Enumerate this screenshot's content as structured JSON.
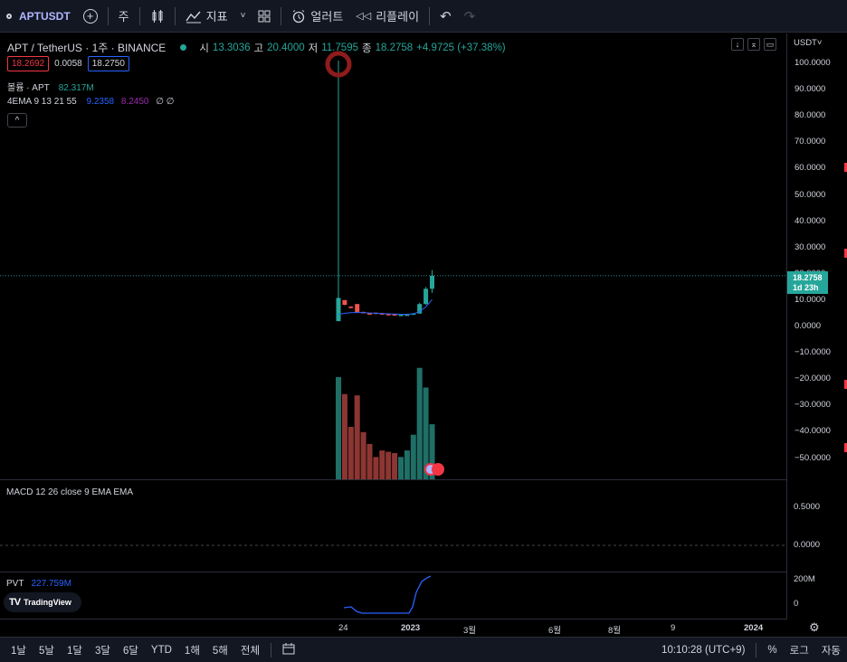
{
  "toolbar": {
    "symbol": "APTUSDT",
    "interval": "주",
    "indicators_label": "지표",
    "alert_label": "얼러트",
    "replay_label": "리플레이"
  },
  "legend": {
    "title": "APT / TetherUS · 1주 · BINANCE",
    "open_label": "시",
    "open": "13.3036",
    "high_label": "고",
    "high": "20.4000",
    "low_label": "저",
    "low": "11.7595",
    "close_label": "종",
    "close": "18.2758",
    "change": "+4.9725 (+37.38%)",
    "bid": "18.2692",
    "spread": "0.0058",
    "ask": "18.2750",
    "volume_label": "볼륨 · APT",
    "volume_value": "82.317M",
    "ema_label": "4EMA 9 13 21 55",
    "ema_v1": "9.2358",
    "ema_v2": "8.2450",
    "ema_rest": "∅ ∅"
  },
  "price_axis": {
    "currency": "USDT˅",
    "ticks": [
      "100.0000",
      "90.0000",
      "80.0000",
      "70.0000",
      "60.0000",
      "50.0000",
      "40.0000",
      "30.0000",
      "20.0000",
      "10.0000",
      "0.0000",
      "−10.0000",
      "−20.0000",
      "−30.0000",
      "−40.0000",
      "−50.0000"
    ],
    "last_price": "18.2758",
    "countdown": "1d 23h"
  },
  "macd": {
    "label": "MACD 12 26 close 9 EMA EMA",
    "ticks": [
      "0.5000",
      "0.0000"
    ]
  },
  "pvt": {
    "label": "PVT",
    "value": "227.759M",
    "ticks": [
      "200M",
      "0"
    ]
  },
  "branding": "TradingView",
  "time_axis": [
    "24",
    "2023",
    "3월",
    "6월",
    "8월",
    "9",
    "2024"
  ],
  "bottombar": {
    "ranges": [
      "1날",
      "5날",
      "1달",
      "3달",
      "6달",
      "YTD",
      "1해",
      "5해",
      "전체"
    ],
    "clock": "10:10:28 (UTC+9)",
    "percent": "%",
    "log": "로그",
    "auto": "자동"
  },
  "colors": {
    "up": "#26a69a",
    "down": "#ef5350",
    "ema_fast": "#2962ff",
    "ema_slow": "#9c27b0",
    "background": "#000000"
  },
  "chart_data": {
    "type": "candlestick",
    "y_range": [
      -55,
      105
    ],
    "candles": [
      {
        "o": 1.0,
        "h": 100.0,
        "l": 1.0,
        "c": 9.8,
        "vol": 78
      },
      {
        "o": 9.0,
        "h": 9.0,
        "l": 7.0,
        "c": 7.2,
        "vol": 65
      },
      {
        "o": 6.5,
        "h": 6.7,
        "l": 5.8,
        "c": 6.0,
        "vol": 40
      },
      {
        "o": 7.5,
        "h": 7.5,
        "l": 4.2,
        "c": 4.5,
        "vol": 64
      },
      {
        "o": 4.5,
        "h": 4.6,
        "l": 4.0,
        "c": 4.1,
        "vol": 36
      },
      {
        "o": 4.0,
        "h": 4.2,
        "l": 3.7,
        "c": 3.9,
        "vol": 27
      },
      {
        "o": 4.2,
        "h": 4.3,
        "l": 4.0,
        "c": 4.0,
        "vol": 17
      },
      {
        "o": 4.0,
        "h": 4.2,
        "l": 3.6,
        "c": 3.8,
        "vol": 22
      },
      {
        "o": 3.7,
        "h": 3.8,
        "l": 3.5,
        "c": 3.6,
        "vol": 21
      },
      {
        "o": 3.6,
        "h": 3.7,
        "l": 3.2,
        "c": 3.3,
        "vol": 20
      },
      {
        "o": 3.2,
        "h": 3.5,
        "l": 3.1,
        "c": 3.4,
        "vol": 17
      },
      {
        "o": 3.3,
        "h": 3.6,
        "l": 3.2,
        "c": 3.5,
        "vol": 22
      },
      {
        "o": 3.5,
        "h": 4.0,
        "l": 3.4,
        "c": 3.9,
        "vol": 34
      },
      {
        "o": 3.9,
        "h": 8.0,
        "l": 3.8,
        "c": 7.5,
        "vol": 85
      },
      {
        "o": 7.5,
        "h": 14.0,
        "l": 7.2,
        "c": 13.3,
        "vol": 70
      },
      {
        "o": 13.3,
        "h": 20.4,
        "l": 11.76,
        "c": 18.28,
        "vol": 42
      }
    ]
  }
}
